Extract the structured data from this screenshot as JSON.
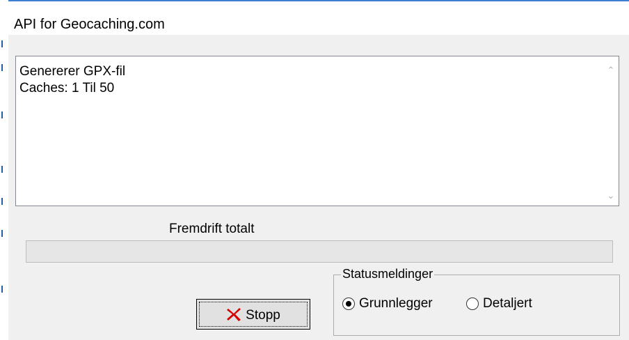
{
  "window": {
    "title": "API for Geocaching.com"
  },
  "log": {
    "lines": [
      "Genererer GPX-fil",
      "Caches: 1 Til 50"
    ]
  },
  "progress": {
    "label": "Fremdrift totalt",
    "value": 0
  },
  "status_group": {
    "legend": "Statusmeldinger",
    "options": [
      {
        "label": "Grunnlegger",
        "checked": true
      },
      {
        "label": "Detaljert",
        "checked": false
      }
    ]
  },
  "stop_button": {
    "label": "Stopp",
    "icon": "red-x-icon",
    "icon_color": "#d40000"
  }
}
